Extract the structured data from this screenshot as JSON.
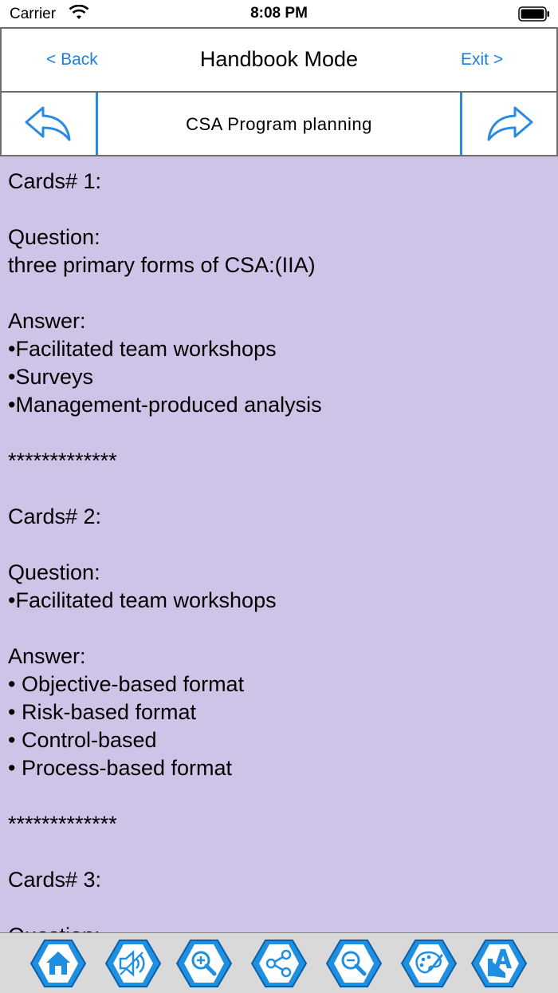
{
  "status": {
    "carrier": "Carrier",
    "time": "8:08 PM"
  },
  "nav": {
    "back_label": "<  Back",
    "title": "Handbook Mode",
    "exit_label": "Exit >"
  },
  "topic": {
    "title": "CSA Program planning",
    "prev_icon": "undo-arrow-icon",
    "next_icon": "redo-arrow-icon"
  },
  "content": {
    "lines": [
      "Cards# 1:",
      "",
      "Question:",
      "three primary forms of CSA:(IIA)",
      "",
      "Answer:",
      "•Facilitated team workshops",
      "•Surveys",
      "•Management-produced analysis",
      "",
      "*************",
      "",
      "Cards# 2:",
      "",
      "Question:",
      "•Facilitated team workshops",
      "",
      "Answer:",
      "• Objective-based format",
      "• Risk-based format",
      "• Control-based",
      "• Process-based format",
      "",
      "*************",
      "",
      "Cards# 3:",
      "",
      "Question:"
    ]
  },
  "toolbar": {
    "buttons": [
      "home-icon",
      "speaker-icon",
      "zoom-in-icon",
      "share-icon",
      "zoom-out-icon",
      "palette-icon",
      "font-style-icon"
    ]
  },
  "colors": {
    "accent": "#1a7fe0",
    "content_bg": "#cfc3e8",
    "hex_fill": "#1e8fe1"
  }
}
